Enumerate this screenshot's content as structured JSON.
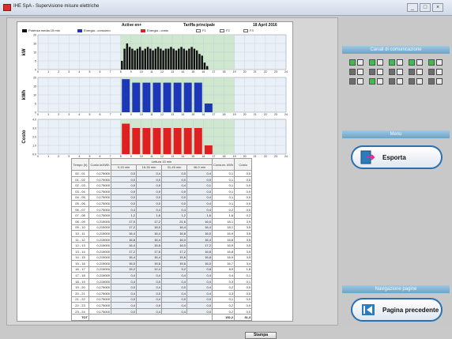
{
  "window": {
    "title": "IHE SpA - Supervisione misure elettriche",
    "min": "_",
    "max": "□",
    "close": "×"
  },
  "report": {
    "active": "Active en+",
    "tariff": "Tariffa principale",
    "date": "18 April 2016",
    "legend": [
      "Potenza media 15 min",
      "Energia - consumo",
      "Energia - costo",
      "F1",
      "F2",
      "F3"
    ],
    "colors": {
      "power": "#111111",
      "energy": "#1c38b8",
      "cost": "#e02020",
      "green_band": "#cfe6cf"
    }
  },
  "chart_data": [
    {
      "type": "bar",
      "ylabel": "kW",
      "ylim": [
        0,
        20
      ],
      "yticks": [
        "20",
        "15",
        "10",
        "5",
        "0"
      ],
      "x": [
        "0",
        "1",
        "2",
        "3",
        "4",
        "5",
        "6",
        "7",
        "8",
        "9",
        "10",
        "11",
        "12",
        "13",
        "14",
        "15",
        "16",
        "17",
        "18",
        "19",
        "20",
        "21",
        "22",
        "23",
        "24"
      ],
      "values": [
        0,
        0,
        0,
        0,
        0,
        0,
        0,
        0,
        0,
        0,
        0,
        0,
        0,
        0,
        0,
        0,
        0,
        0,
        0,
        0,
        0,
        0,
        0,
        0,
        0,
        0,
        0,
        0,
        0,
        0,
        0,
        0,
        5,
        12,
        15,
        13,
        12,
        11,
        12,
        13,
        11,
        12,
        13,
        12,
        11,
        12,
        13,
        12,
        11,
        12,
        12,
        13,
        12,
        11,
        12,
        13,
        12,
        11,
        12,
        13,
        12,
        11,
        9,
        8,
        4,
        2,
        0,
        0,
        0,
        0,
        0,
        0,
        0,
        0,
        0,
        0,
        0,
        0,
        0,
        0,
        0,
        0,
        0,
        0,
        0,
        0,
        0,
        0,
        0,
        0,
        0,
        0,
        0,
        0,
        0,
        0
      ]
    },
    {
      "type": "bar",
      "ylabel": "kWh",
      "ylim": [
        0,
        20
      ],
      "yticks": [
        "20",
        "15",
        "10",
        "5",
        "0"
      ],
      "x": [
        "0",
        "1",
        "2",
        "3",
        "4",
        "5",
        "6",
        "7",
        "8",
        "9",
        "10",
        "11",
        "12",
        "13",
        "14",
        "15",
        "16",
        "17",
        "18",
        "19",
        "20",
        "21",
        "22",
        "23",
        "24"
      ],
      "values": [
        0,
        0,
        0,
        0,
        0,
        0,
        0,
        0,
        19,
        17,
        17,
        17,
        17,
        17,
        17,
        17,
        5,
        0,
        0,
        0,
        0,
        0,
        0,
        0
      ]
    },
    {
      "type": "bar",
      "ylabel": "Costo",
      "ylim": [
        0,
        4
      ],
      "yticks": [
        "4.0",
        "3.0",
        "2.0",
        "1.0",
        "0.0"
      ],
      "x": [
        "0",
        "1",
        "2",
        "3",
        "4",
        "5",
        "6",
        "7",
        "8",
        "9",
        "10",
        "11",
        "12",
        "13",
        "14",
        "15",
        "16",
        "17",
        "18",
        "19",
        "20",
        "21",
        "22",
        "23",
        "24"
      ],
      "values": [
        0,
        0,
        0,
        0,
        0,
        0,
        0,
        0,
        3.5,
        3.0,
        3.0,
        3.0,
        3.0,
        3.0,
        3.0,
        3.0,
        1.0,
        0,
        0,
        0,
        0,
        0,
        0,
        0
      ]
    }
  ],
  "table": {
    "head_top": [
      "Tempo (h)",
      "Costo kr/kWh",
      "Lettura 15 min",
      "Consum. kWh",
      "Costo"
    ],
    "head_sub": [
      "0-15 min",
      "16-30 min",
      "31-45 min",
      "46-0 min"
    ],
    "rows": [
      [
        "00 - 01",
        "0,175000",
        "0,0",
        "0,4",
        "0,0",
        "0,4",
        "0,1",
        "0,0"
      ],
      [
        "01 - 02",
        "0,175000",
        "0,0",
        "0,0",
        "0,0",
        "0,0",
        "0,1",
        "0,0"
      ],
      [
        "02 - 03",
        "0,175000",
        "0,0",
        "0,0",
        "0,4",
        "0,1",
        "0,1",
        "0,0"
      ],
      [
        "03 - 04",
        "0,175000",
        "0,0",
        "0,0",
        "0,0",
        "0,0",
        "0,1",
        "0,0"
      ],
      [
        "04 - 05",
        "0,175000",
        "0,0",
        "0,0",
        "0,0",
        "0,4",
        "0,1",
        "0,0"
      ],
      [
        "05 - 06",
        "0,175000",
        "0,0",
        "0,0",
        "0,0",
        "0,4",
        "0,1",
        "0,0"
      ],
      [
        "06 - 07",
        "0,175000",
        "0,4",
        "0,4",
        "0,4",
        "0,4",
        "0,2",
        "0,0"
      ],
      [
        "07 - 08",
        "0,175000",
        "1,2",
        "1,6",
        "1,2",
        "1,6",
        "1,6",
        "0,2"
      ],
      [
        "08 - 09",
        "0,215000",
        "17,0",
        "17,2",
        "21,6",
        "16,0",
        "18,1",
        "3,9"
      ],
      [
        "09 - 10",
        "0,215000",
        "17,2",
        "18,0",
        "16,4",
        "16,4",
        "18,1",
        "3,5"
      ],
      [
        "10 - 11",
        "0,215000",
        "16,4",
        "16,4",
        "16,8",
        "16,0",
        "16,9",
        "3,5"
      ],
      [
        "11 - 12",
        "0,215000",
        "16,8",
        "16,4",
        "16,0",
        "16,4",
        "16,8",
        "3,5"
      ],
      [
        "12 - 13",
        "0,215000",
        "16,4",
        "15,6",
        "16,0",
        "17,2",
        "16,9",
        "3,5"
      ],
      [
        "13 - 14",
        "0,215000",
        "17,2",
        "17,6",
        "17,2",
        "16,8",
        "16,8",
        "3,5"
      ],
      [
        "14 - 15",
        "0,215000",
        "16,4",
        "16,4",
        "15,6",
        "16,8",
        "16,9",
        "3,5"
      ],
      [
        "15 - 16",
        "0,215000",
        "16,0",
        "15,6",
        "15,6",
        "16,0",
        "16,7",
        "3,4"
      ],
      [
        "16 - 17",
        "0,215000",
        "15,2",
        "12,4",
        "5,2",
        "0,8",
        "8,0",
        "1,8"
      ],
      [
        "17 - 18",
        "0,215000",
        "0,4",
        "0,4",
        "0,4",
        "0,4",
        "0,4",
        "0,1"
      ],
      [
        "18 - 19",
        "0,215000",
        "0,4",
        "0,0",
        "0,4",
        "0,4",
        "0,3",
        "0,1"
      ],
      [
        "19 - 20",
        "0,175000",
        "0,0",
        "0,4",
        "0,0",
        "0,4",
        "0,2",
        "0,0"
      ],
      [
        "20 - 21",
        "0,175000",
        "0,4",
        "0,0",
        "0,4",
        "0,4",
        "0,3",
        "0,0"
      ],
      [
        "21 - 22",
        "0,175000",
        "0,0",
        "0,4",
        "0,0",
        "0,0",
        "0,1",
        "0,0"
      ],
      [
        "22 - 23",
        "0,175000",
        "0,4",
        "0,0",
        "0,4",
        "0,0",
        "0,2",
        "0,0"
      ],
      [
        "23 - 24",
        "0,175000",
        "0,0",
        "0,4",
        "0,4",
        "0,0",
        "0,2",
        "0,0"
      ]
    ],
    "total_label": "TOT",
    "total_kwh": "152,2",
    "total_cost": "31,3"
  },
  "print_label": "Stampa",
  "side": {
    "channels_title": "Canali di comunicazione",
    "menu_title": "Menu",
    "export_label": "Esporta",
    "nav_title": "Navigazione pagine",
    "prev_label": "Pagina precedente",
    "channel_states": [
      true,
      true,
      true,
      true,
      true,
      false,
      false,
      false,
      false,
      false,
      false,
      true,
      false,
      false,
      false
    ]
  }
}
